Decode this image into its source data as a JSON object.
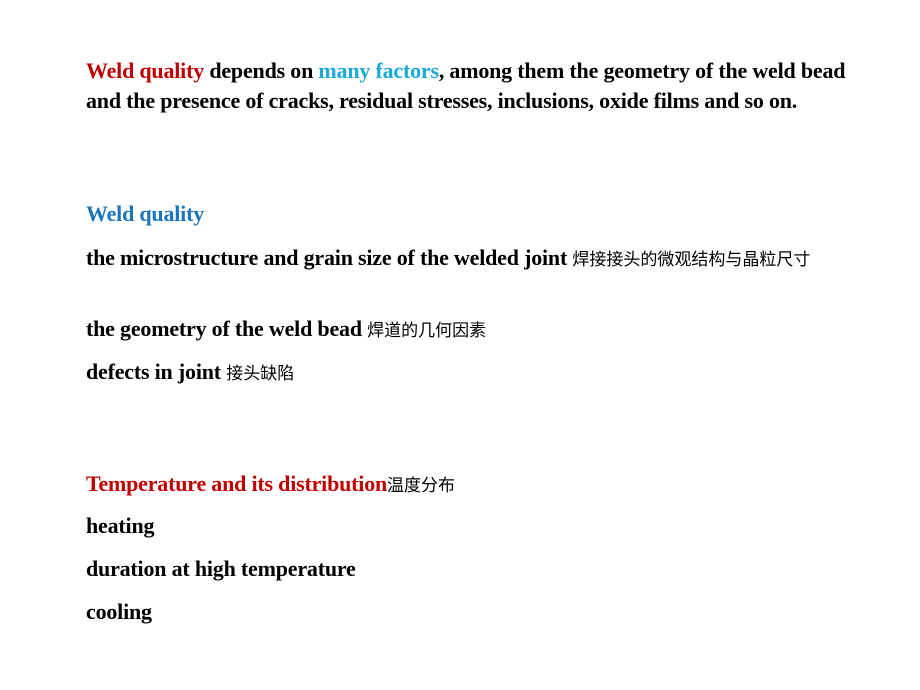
{
  "intro": {
    "highlight1": "Weld quality",
    "text1": " depends on ",
    "highlight2": "many factors",
    "text2": ", among them the geometry of the weld bead and the presence of cracks, residual stresses, inclusions, oxide films and so on."
  },
  "weld_quality": {
    "heading": "Weld quality",
    "items": [
      {
        "en": "the microstructure and grain size of the welded joint ",
        "zh": "焊接接头的微观结构与晶粒尺寸"
      },
      {
        "en": "the geometry of the weld bead ",
        "zh": "焊道的几何因素"
      },
      {
        "en": "defects in joint ",
        "zh": "接头缺陷"
      }
    ]
  },
  "temperature": {
    "heading": "Temperature and its distribution",
    "heading_zh": "温度分布",
    "items": [
      "heating",
      "duration at high temperature",
      "cooling"
    ]
  },
  "colors": {
    "red": "#C00000",
    "cyan": "#1BA8DA",
    "blue": "#1B75BB",
    "text": "#000000"
  }
}
